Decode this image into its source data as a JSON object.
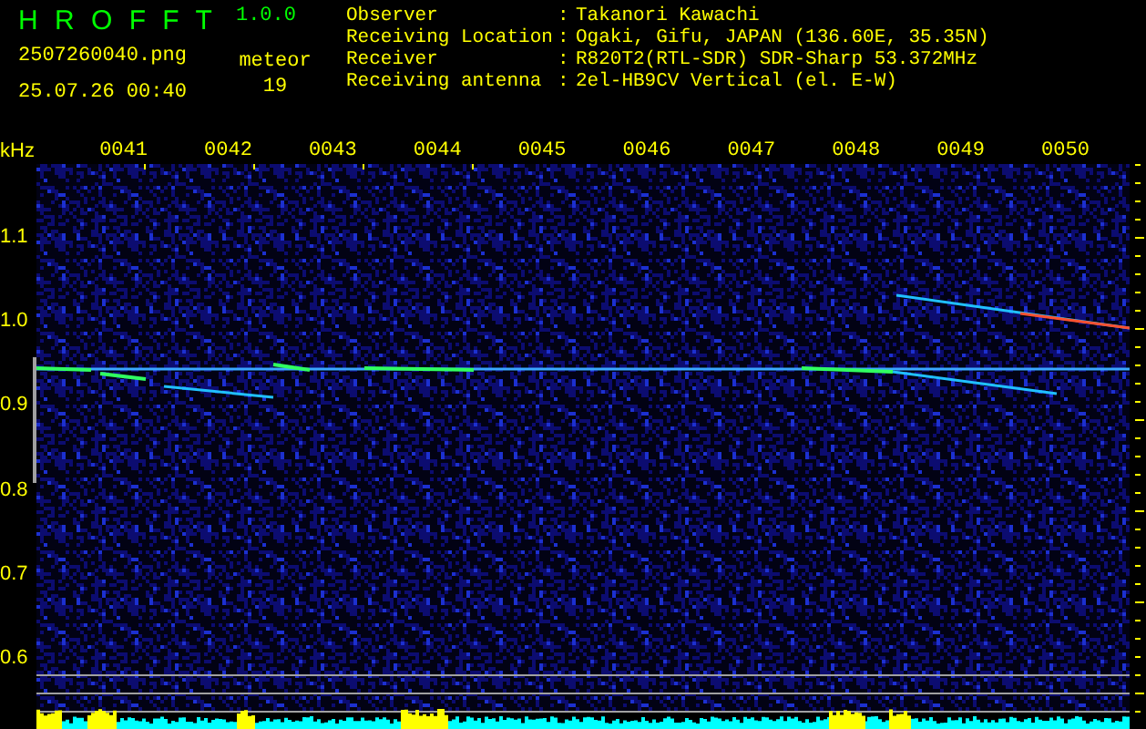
{
  "app": {
    "title": "H R O F F T",
    "version": "1.0.0",
    "filename": "2507260040.png",
    "datetime": "25.07.26 00:40",
    "meteor_label": "meteor",
    "meteor_count": "19"
  },
  "info": [
    {
      "label": "Observer",
      "value": "Takanori Kawachi"
    },
    {
      "label": "Receiving Location",
      "value": "Ogaki, Gifu, JAPAN (136.60E, 35.35N)"
    },
    {
      "label": "Receiver",
      "value": "R820T2(RTL-SDR) SDR-Sharp 53.372MHz"
    },
    {
      "label": "Receiving antenna",
      "value": "2el-HB9CV Vertical (el. E-W)"
    }
  ],
  "separator": ":",
  "axis": {
    "unit": "kHz",
    "x_labels": [
      "0041",
      "0042",
      "0043",
      "0044",
      "0045",
      "0046",
      "0047",
      "0048",
      "0049",
      "0050"
    ],
    "y_labels": [
      "1.1",
      "1.0",
      "0.9",
      "0.8",
      "0.7",
      "0.6"
    ]
  }
}
